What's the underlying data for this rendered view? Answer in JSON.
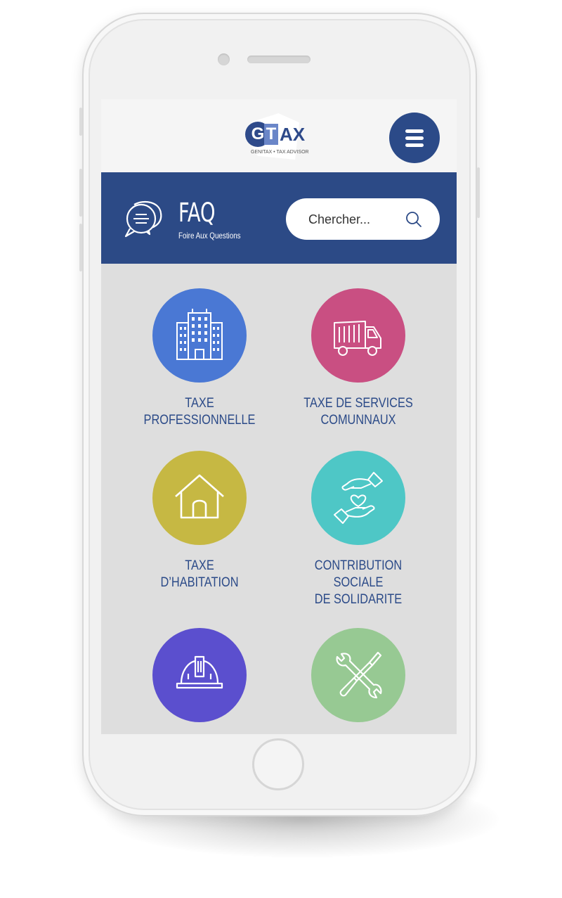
{
  "header": {
    "logo": {
      "g": "G",
      "t": "T",
      "ax": "AX",
      "tagline": "GENITAX • TAX ADVISOR"
    }
  },
  "banner": {
    "title": "FAQ",
    "subtitle": "Foire Aux Questions",
    "search_placeholder": "Chercher..."
  },
  "categories": [
    {
      "label": "TAXE\nPROFESSIONNELLE",
      "color": "#4a78d4",
      "icon": "building-icon"
    },
    {
      "label": "TAXE DE SERVICES\nCOMUNNAUX",
      "color": "#c94f82",
      "icon": "garbage-truck-icon"
    },
    {
      "label": "TAXE\nD’HABITATION",
      "color": "#c6b843",
      "icon": "house-icon"
    },
    {
      "label": "CONTRIBUTION SOCIALE\nDE SOLIDARITE",
      "color": "#4ec7c6",
      "icon": "helping-hands-heart-icon"
    },
    {
      "label": "",
      "color": "#5b4fce",
      "icon": "hard-hat-icon"
    },
    {
      "label": "",
      "color": "#97c993",
      "icon": "tools-icon"
    }
  ],
  "colors": {
    "brand_blue": "#2c4a86",
    "screen_bg": "#dedede"
  }
}
